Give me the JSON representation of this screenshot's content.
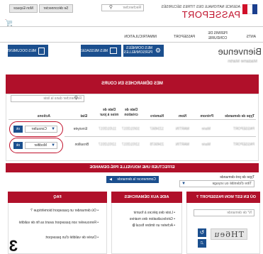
{
  "header": {
    "espace_label": "Mon Espace",
    "logout_label": "Se déconnecter",
    "search_placeholder": "Rechercher",
    "agency_name": "AGENCE NATIONALE DES TITRES SÉCURISÉS",
    "brand": "PASSEPORT"
  },
  "nav": [
    "ANTS",
    "PERMIS DE CONDUIRE",
    "PASSEPORT",
    "IMMATRICULATION"
  ],
  "welcome": {
    "title": "Bienvenue",
    "subtitle": "Madame Martin"
  },
  "actions": {
    "donnees": "MES DONNÉES PERSONNELLES",
    "messages": "MES MESSAGES",
    "documents": "MES DOCUMENTS"
  },
  "demarches": {
    "title": "MES DÉMARCHES EN COURS",
    "search_placeholder": "Rechercher dans la liste",
    "columns": [
      "Type de demande",
      "Prénom",
      "Nom",
      "Numéro",
      "Date de création",
      "Date de mise à jour",
      "Etat",
      "Actions"
    ],
    "rows": [
      {
        "type": "PASSEPORT",
        "prenom": "Marie",
        "nom": "MARTIN",
        "numero": "1234567",
        "created": "10/01/2017",
        "updated": "11/01/2017",
        "etat": "Envoyée",
        "action": "Consulter"
      },
      {
        "type": "PASSEPORT",
        "prenom": "Marie",
        "nom": "MARTIN",
        "numero": "2345678",
        "created": "12/01/2017",
        "updated": "12/01/2017",
        "etat": "Brouillon",
        "action": "Modifier"
      }
    ]
  },
  "pre_demande": {
    "title": "EFFECTUER UNE NOUVELLE PRÉ-DEMANDE",
    "type_label": "Type de pré-demande",
    "select_value": "Titre d'identité ou voyage",
    "button": "Commencer la demande"
  },
  "cards": {
    "ou_en_est": {
      "title": "OÙ EN EST MON PASSEPORT ?",
      "input_placeholder": "N° de demande",
      "captcha": "TH6eu"
    },
    "aide": {
      "title": "AIDE AUX DÉMARCHES",
      "items": [
        "Liste des pièces à fournir",
        "Géolocalisation des mairies",
        "Acheter un timbre fiscal"
      ]
    },
    "faq": {
      "title": "FAQ",
      "items": [
        "Où demander un passeport biométrique ?",
        "Renouveler son passeport avant sa fin de validité",
        "Durée de validité d'un passeport"
      ]
    }
  },
  "badge": "3",
  "colors": {
    "accent": "#b0102a",
    "button_blue": "#1b4f8e"
  }
}
